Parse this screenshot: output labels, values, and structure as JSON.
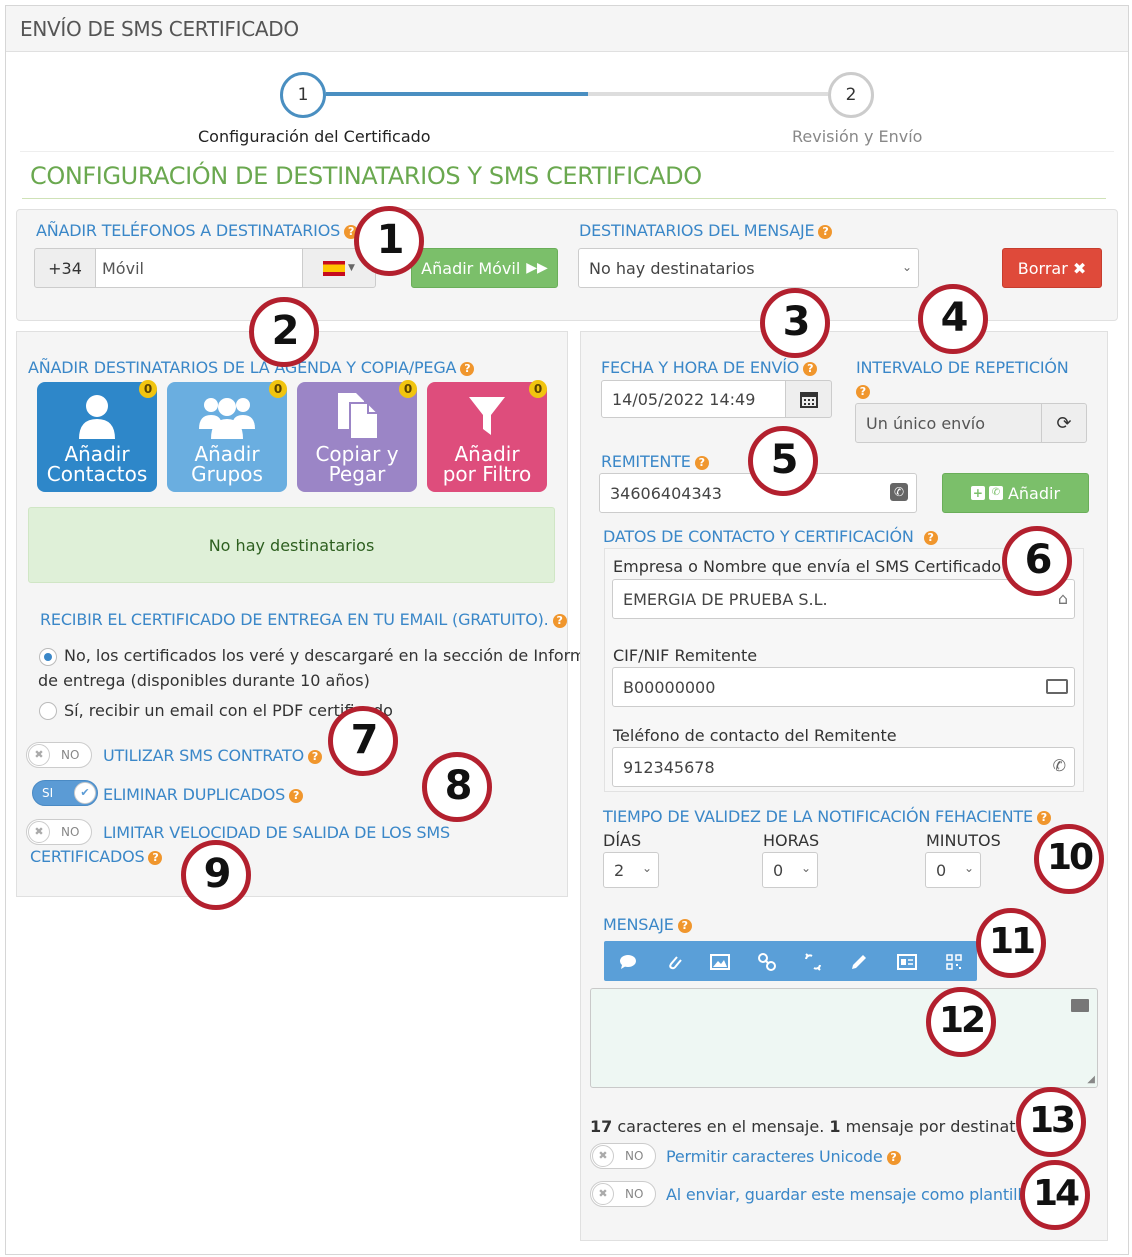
{
  "window": {
    "title": "ENVÍO DE SMS CERTIFICADO"
  },
  "steps": [
    {
      "number": "1",
      "label": "Configuración del Certificado"
    },
    {
      "number": "2",
      "label": "Revisión y Envío"
    }
  ],
  "section_title": "CONFIGURACIÓN DE DESTINATARIOS Y SMS CERTIFICADO",
  "add_phones": {
    "label": "AÑADIR TELÉFONOS A DESTINATARIOS",
    "prefix": "+34",
    "placeholder": "Móvil",
    "add_button": "Añadir Móvil"
  },
  "recipients": {
    "label": "DESTINATARIOS DEL MENSAJE",
    "selected": "No hay destinatarios",
    "clear_button": "Borrar"
  },
  "agenda": {
    "label": "AÑADIR DESTINATARIOS DE LA AGENDA Y COPIA/PEGA",
    "tiles": [
      {
        "line1": "Añadir",
        "line2": "Contactos",
        "badge": "0",
        "color": "#2e87c9"
      },
      {
        "line1": "Añadir",
        "line2": "Grupos",
        "badge": "0",
        "color": "#6aaee0"
      },
      {
        "line1": "Copiar y",
        "line2": "Pegar",
        "badge": "0",
        "color": "#9b85c6"
      },
      {
        "line1": "Añadir",
        "line2": "por Filtro",
        "badge": "0",
        "color": "#de4d7c"
      }
    ],
    "empty_message": "No hay destinatarios"
  },
  "certificate_email": {
    "label": "RECIBIR EL CERTIFICADO DE ENTREGA EN TU EMAIL (GRATUITO).",
    "option_no_line1": "No, los certificados los veré y descargaré en la sección de Informes",
    "option_no_line2": "de entrega (disponibles durante 10 años)",
    "option_yes": "Sí, recibir un email con el PDF certificado"
  },
  "toggles": {
    "contract": {
      "state": "NO",
      "label": "UTILIZAR SMS CONTRATO"
    },
    "duplicates": {
      "state": "SI",
      "label": "ELIMINAR DUPLICADOS"
    },
    "speed": {
      "state": "NO",
      "label_line1": "LIMITAR VELOCIDAD DE SALIDA DE LOS SMS",
      "label_line2": "CERTIFICADOS"
    },
    "unicode": {
      "state": "NO",
      "label": "Permitir caracteres Unicode"
    },
    "template": {
      "state": "NO",
      "label": "Al enviar, guardar este mensaje como plantilla"
    }
  },
  "send_date": {
    "label": "FECHA Y HORA DE ENVÍO",
    "value": "14/05/2022 14:49"
  },
  "interval": {
    "label": "INTERVALO DE REPETICIÓN",
    "value": "Un único envío"
  },
  "sender": {
    "label": "REMITENTE",
    "value": "34606404343",
    "add_button": "Añadir"
  },
  "contact_data": {
    "label": "DATOS DE CONTACTO Y CERTIFICACIÓN",
    "company_label": "Empresa o Nombre que envía el SMS Certificado",
    "company_value": "EMERGIA DE PRUEBA S.L.",
    "cif_label": "CIF/NIF Remitente",
    "cif_value": "B00000000",
    "phone_label": "Teléfono de contacto del Remitente",
    "phone_value": "912345678"
  },
  "validity": {
    "label": "TIEMPO DE VALIDEZ DE LA NOTIFICACIÓN FEHACIENTE",
    "days_label": "DÍAS",
    "days_value": "2",
    "hours_label": "HORAS",
    "hours_value": "0",
    "minutes_label": "MINUTOS",
    "minutes_value": "0"
  },
  "message": {
    "label": "MENSAJE",
    "toolbar_icons": [
      "speech-bubble-icon",
      "paperclip-icon",
      "image-icon",
      "link-icon",
      "unlink-icon",
      "pencil-icon",
      "id-card-icon",
      "qr-code-icon"
    ],
    "count_chars": "17",
    "count_chars_text": "caracteres en el mensaje.",
    "count_msgs": "1",
    "count_msgs_text": "mensaje por destinatario."
  },
  "callouts": [
    "1",
    "2",
    "3",
    "4",
    "5",
    "6",
    "7",
    "8",
    "9",
    "10",
    "11",
    "12",
    "13",
    "14"
  ],
  "colors": {
    "accent_blue": "#3a87c8",
    "green": "#6aa84f",
    "red": "#df4a3a",
    "callout": "#b3202e"
  }
}
